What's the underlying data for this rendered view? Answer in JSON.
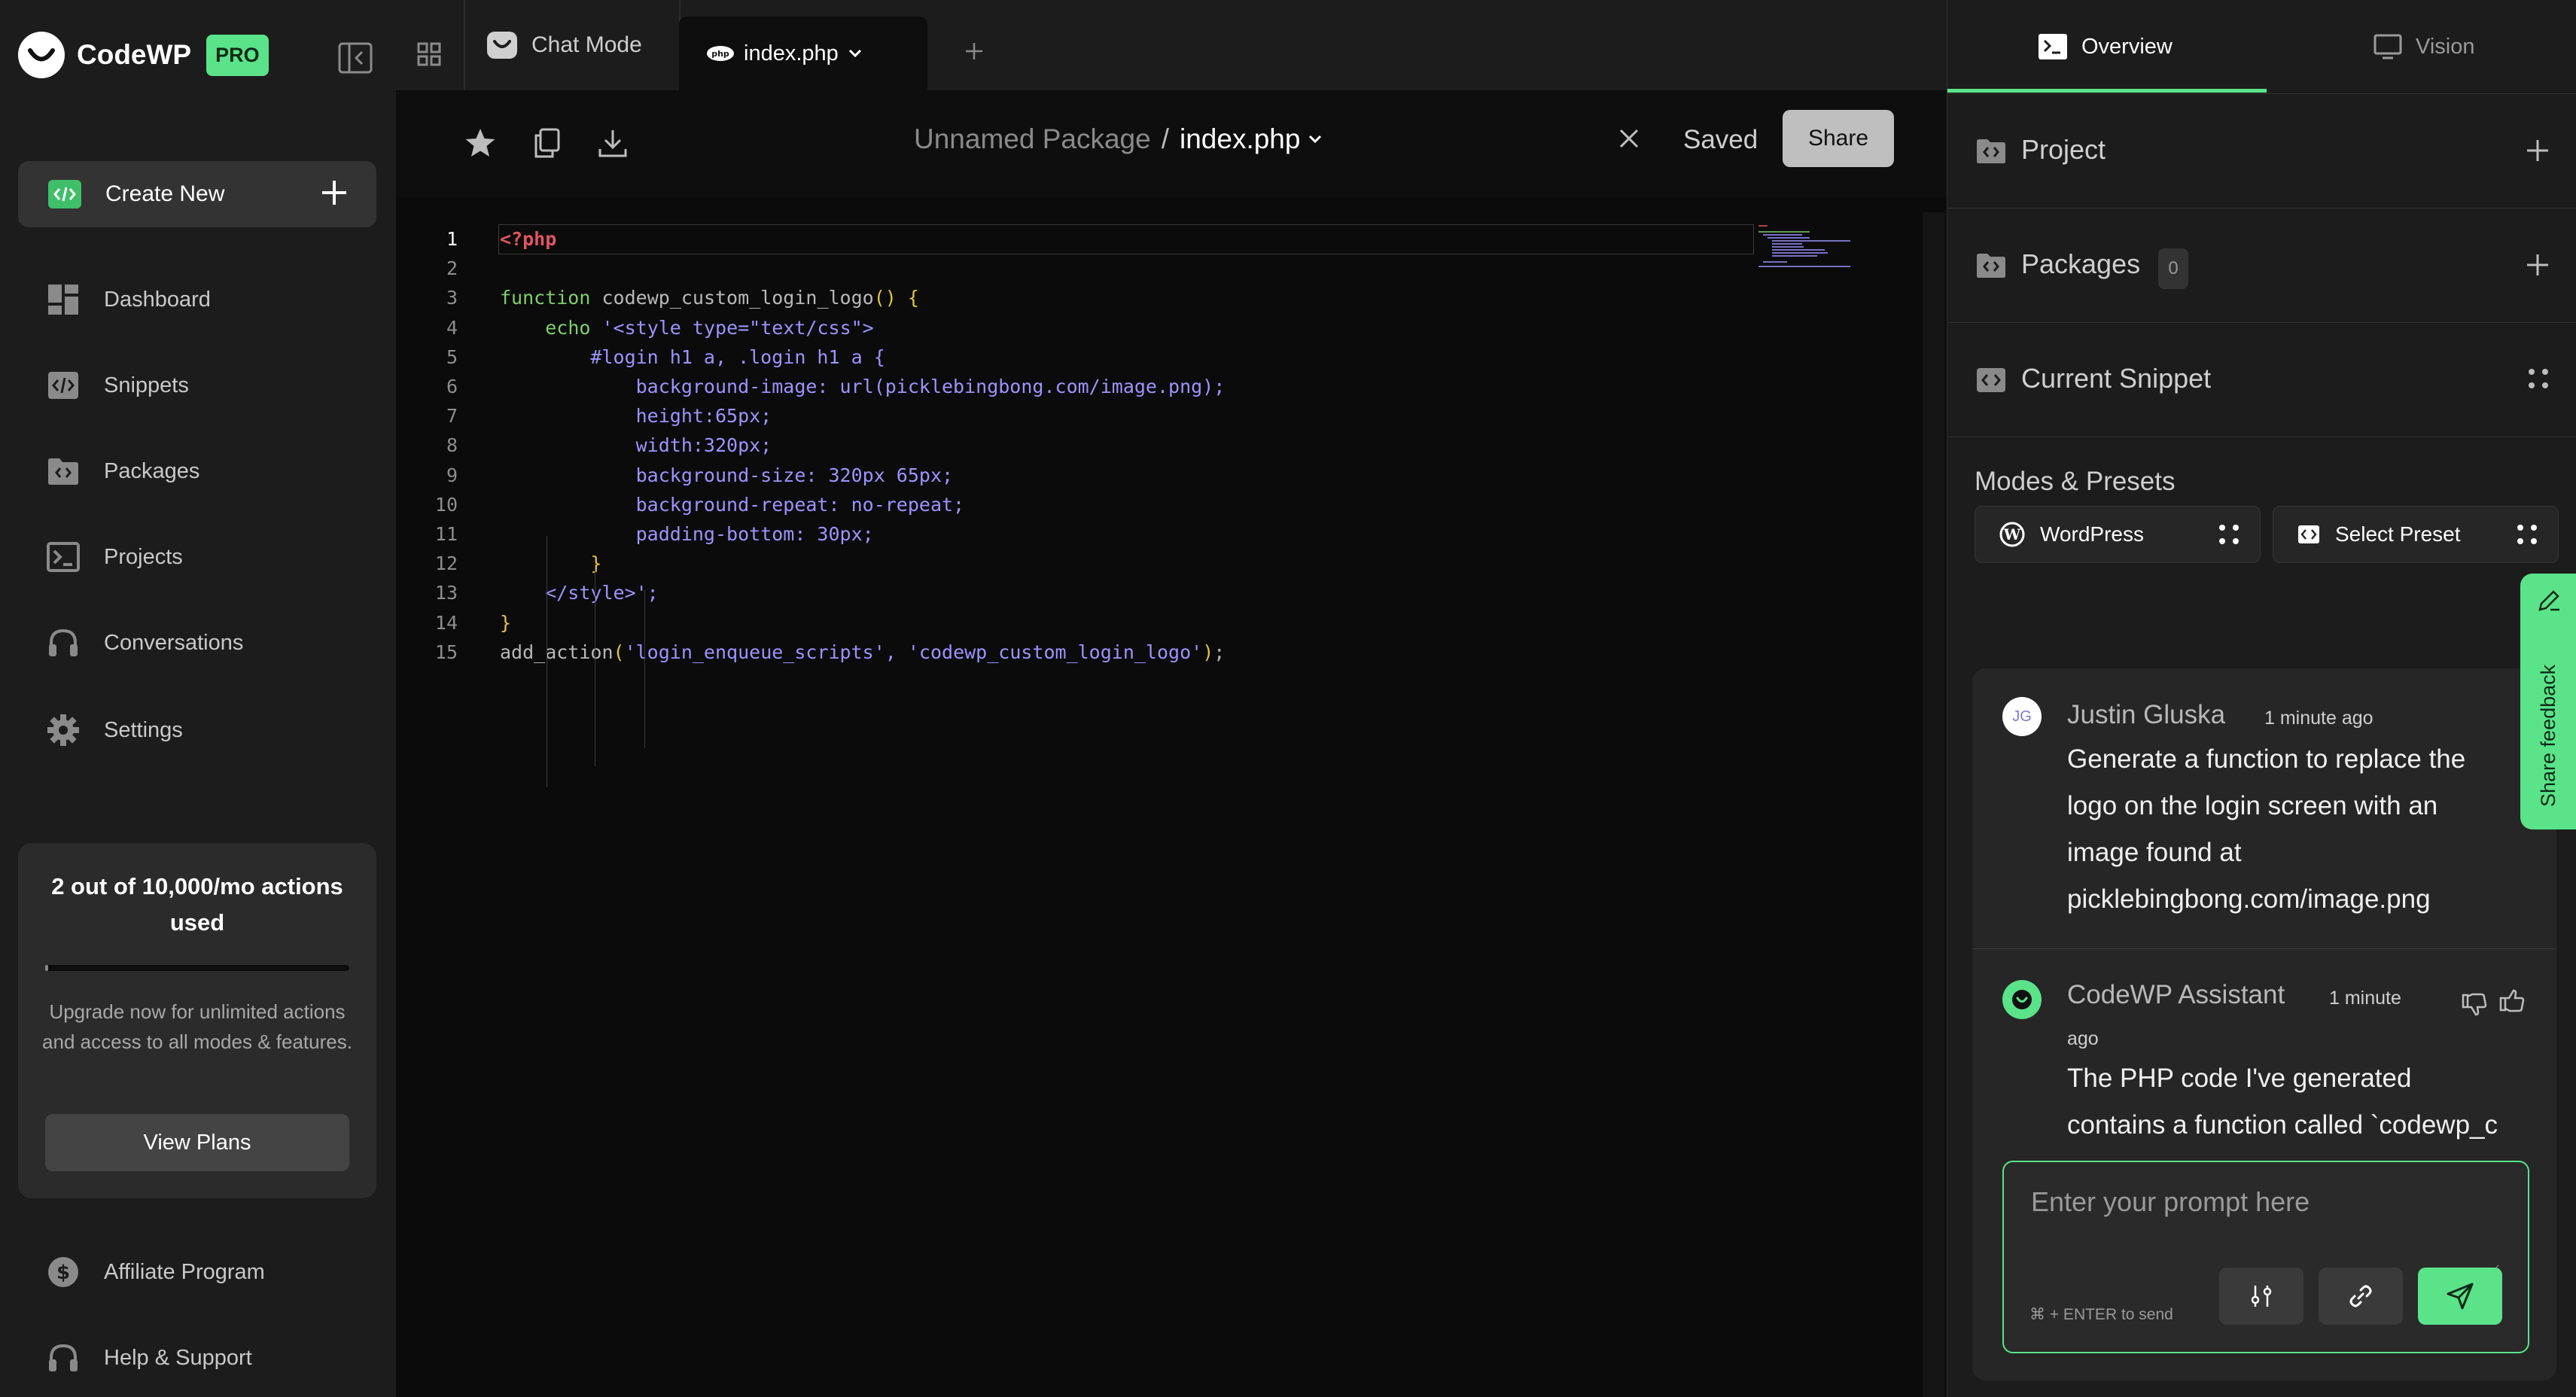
{
  "app": {
    "name": "CodeWP",
    "badge": "PRO"
  },
  "sidebar": {
    "create_new_label": "Create New",
    "items": [
      {
        "label": "Dashboard",
        "icon": "dashboard-icon"
      },
      {
        "label": "Snippets",
        "icon": "code-icon"
      },
      {
        "label": "Packages",
        "icon": "folder-code-icon"
      },
      {
        "label": "Projects",
        "icon": "terminal-icon"
      },
      {
        "label": "Conversations",
        "icon": "headphones-icon"
      },
      {
        "label": "Settings",
        "icon": "gear-icon"
      }
    ],
    "usage": {
      "title": "2 out of 10,000/mo actions used",
      "used": 2,
      "limit": 10000,
      "description": "Upgrade now for unlimited actions and access to all modes & features.",
      "button_label": "View Plans"
    },
    "footer_items": [
      {
        "label": "Affiliate Program",
        "icon": "dollar-icon"
      },
      {
        "label": "Help & Support",
        "icon": "headset-icon"
      }
    ]
  },
  "tabs": {
    "chat_mode_label": "Chat Mode",
    "file_tab_label": "index.php"
  },
  "editor": {
    "breadcrumb_package": "Unnamed Package",
    "breadcrumb_separator": "/",
    "breadcrumb_file": "index.php",
    "status": "Saved",
    "share_label": "Share",
    "active_line": 1,
    "lines": [
      "<?php",
      "",
      "function codewp_custom_login_logo() {",
      "    echo '<style type=\"text/css\">",
      "        #login h1 a, .login h1 a {",
      "            background-image: url(picklebingbong.com/image.png);",
      "            height:65px;",
      "            width:320px;",
      "            background-size: 320px 65px;",
      "            background-repeat: no-repeat;",
      "            padding-bottom: 30px;",
      "        }",
      "    </style>';",
      "}",
      "add_action('login_enqueue_scripts', 'codewp_custom_login_logo');"
    ]
  },
  "right_panel": {
    "tabs": [
      {
        "label": "Overview",
        "active": true
      },
      {
        "label": "Vision",
        "active": false
      }
    ],
    "sections": {
      "project_title": "Project",
      "packages_title": "Packages",
      "packages_count": "0",
      "current_snippet_title": "Current Snippet"
    },
    "modes": {
      "title": "Modes & Presets",
      "mode_label": "WordPress",
      "preset_label": "Select Preset"
    },
    "feedback_label": "Share feedback",
    "chat": {
      "messages": [
        {
          "avatar": "JG",
          "author": "Justin Gluska",
          "time": "1 minute ago",
          "text": "Generate a function to replace the logo on the login screen with an image found at picklebingbong.com/image.png"
        },
        {
          "author": "CodeWP Assistant",
          "time_line1": "1 minute",
          "time_line2": "ago",
          "text": "The PHP code I've generated contains a function called `codewp_c"
        }
      ],
      "prompt_placeholder": "Enter your prompt here",
      "prompt_value": "",
      "send_hint": "⌘ + ENTER to send"
    }
  },
  "colors": {
    "accent": "#5be38a",
    "keyword": "#7fce6e",
    "string": "#9d93ff",
    "php_tag": "#e05561",
    "paren": "#e4c145"
  }
}
